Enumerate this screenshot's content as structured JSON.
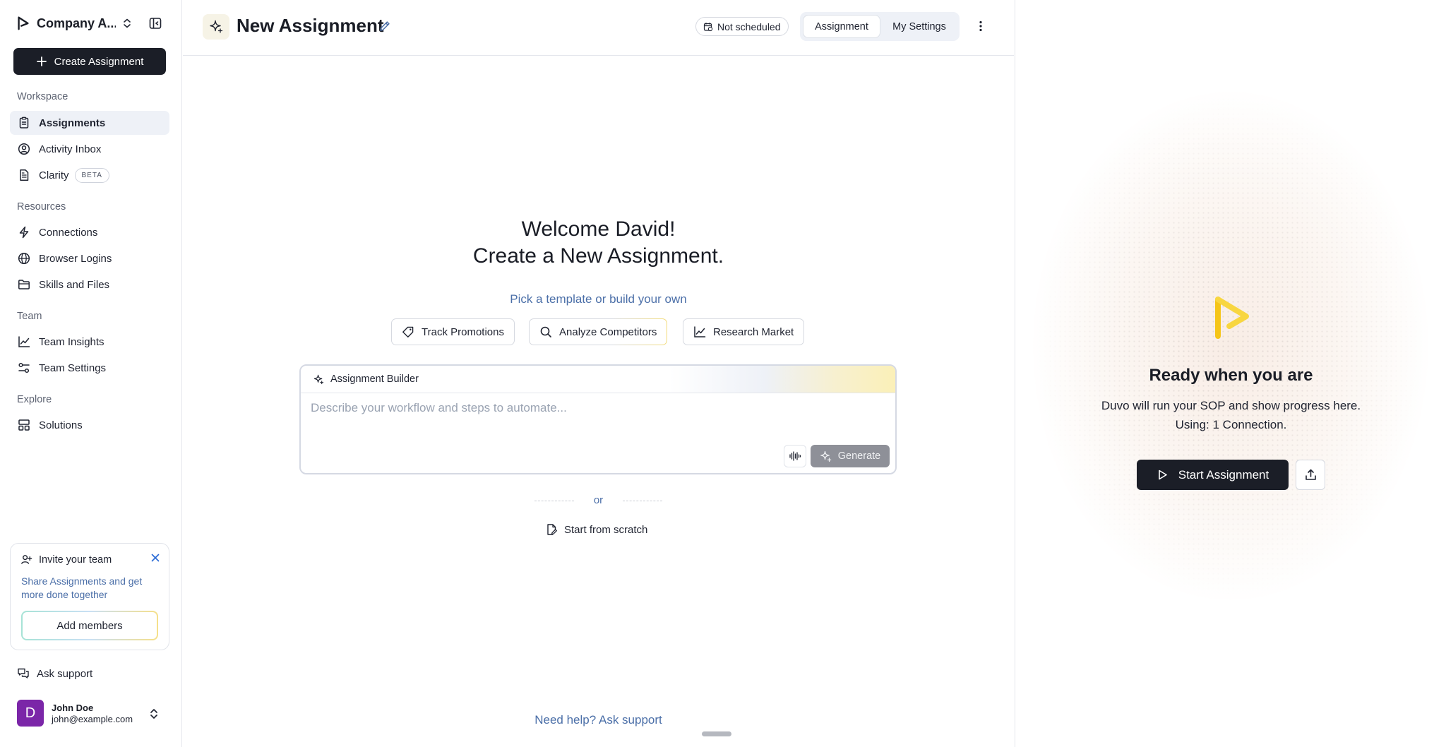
{
  "sidebar": {
    "brand": "Company A...",
    "create_label": "Create Assignment",
    "sections": {
      "workspace": "Workspace",
      "resources": "Resources",
      "team": "Team",
      "explore": "Explore"
    },
    "items": {
      "assignments": "Assignments",
      "activity_inbox": "Activity Inbox",
      "clarity": "Clarity",
      "clarity_badge": "BETA",
      "connections": "Connections",
      "browser_logins": "Browser Logins",
      "skills_files": "Skills and Files",
      "team_insights": "Team Insights",
      "team_settings": "Team Settings",
      "solutions": "Solutions"
    },
    "invite": {
      "title": "Invite your team",
      "description": "Share Assignments and get more done together",
      "button": "Add members"
    },
    "ask_support": "Ask support",
    "user": {
      "initial": "D",
      "name": "John Doe",
      "email": "john@example.com"
    }
  },
  "header": {
    "title": "New Assignment",
    "schedule": "Not scheduled",
    "tabs": [
      "Assignment",
      "My Settings"
    ]
  },
  "main": {
    "welcome_line1": "Welcome David!",
    "welcome_line2": "Create a New Assignment.",
    "pick": "Pick a template or build your own",
    "templates": [
      "Track Promotions",
      "Analyze Competitors",
      "Research Market"
    ],
    "builder_title": "Assignment Builder",
    "builder_placeholder": "Describe your workflow and steps to automate...",
    "generate": "Generate",
    "or": "or",
    "scratch": "Start from scratch",
    "help": "Need help? Ask support"
  },
  "right": {
    "title": "Ready when you are",
    "desc_line1": "Duvo will run your SOP and show progress here.",
    "desc_line2": "Using: 1 Connection.",
    "start": "Start Assignment"
  },
  "colors": {
    "accent_dark": "#1b1e27",
    "link_blue": "#4b6fa8",
    "avatar": "#7b26a8",
    "logo_yellow": "#f5c518"
  },
  "icons": {
    "brand": "play-triangle-logo",
    "assignments": "clipboard-icon",
    "activity_inbox": "user-circle-icon",
    "clarity": "document-icon",
    "connections": "bolt-icon",
    "browser_logins": "globe-icon",
    "skills_files": "folder-icon",
    "team_insights": "line-chart-icon",
    "team_settings": "sliders-icon",
    "solutions": "layout-grid-icon"
  }
}
